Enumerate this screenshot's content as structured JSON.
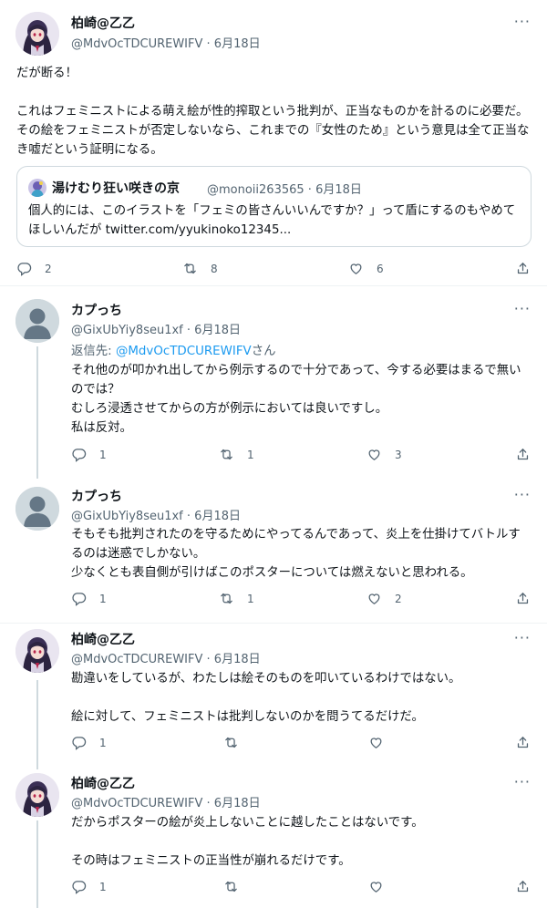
{
  "main_tweet": {
    "name": "柏崎@乙乙",
    "handle": "@MdvOcTDCUREWIFV",
    "date": "6月18日",
    "text": "だが断る！\n\nこれはフェミニストによる萌え絵が性的搾取という批判が、正当なものかを計るのに必要だ。その絵をフェミニストが否定しないなら、これまでの『女性のため』という意見は全て正当なき嘘だという証明になる。",
    "replies": "2",
    "retweets": "8",
    "likes": "6",
    "quote": {
      "name": "湯けむり狂い咲きの京",
      "handle": "@monoii263565",
      "date": "6月18日",
      "text": "個人的には、このイラストを「フェミの皆さんいいんですか？」って盾にするのもやめてほしいんだが twitter.com/yyukinoko12345..."
    }
  },
  "replies": [
    {
      "name": "カプっち",
      "handle": "@GixUbYiy8seu1xf",
      "date": "6月18日",
      "reply_prefix": "返信先: ",
      "reply_target": "@MdvOcTDCUREWIFV",
      "reply_suffix": "さん",
      "text": "それ他のが叩かれ出してから例示するので十分であって、今する必要はまるで無いのでは？\nむしろ浸透させてからの方が例示においては良いですし。\n私は反対。",
      "replies": "1",
      "retweets": "1",
      "likes": "3"
    },
    {
      "name": "カプっち",
      "handle": "@GixUbYiy8seu1xf",
      "date": "6月18日",
      "text": "そもそも批判されたのを守るためにやってるんであって、炎上を仕掛けてバトルするのは迷惑でしかない。\n少なくとも表自側が引けばこのポスターについては燃えないと思われる。",
      "replies": "1",
      "retweets": "1",
      "likes": "2"
    },
    {
      "name": "柏崎@乙乙",
      "handle": "@MdvOcTDCUREWIFV",
      "date": "6月18日",
      "text": "勘違いをしているが、わたしは絵そのものを叩いているわけではない。\n\n絵に対して、フェミニストは批判しないのかを問うてるだけだ。",
      "replies": "1",
      "retweets": "",
      "likes": ""
    },
    {
      "name": "柏崎@乙乙",
      "handle": "@MdvOcTDCUREWIFV",
      "date": "6月18日",
      "text": "だからポスターの絵が炎上しないことに越したことはないです。\n\nその時はフェミニストの正当性が崩れるだけです。",
      "replies": "1",
      "retweets": "",
      "likes": ""
    }
  ],
  "separator": " · ",
  "more_glyph": "···"
}
